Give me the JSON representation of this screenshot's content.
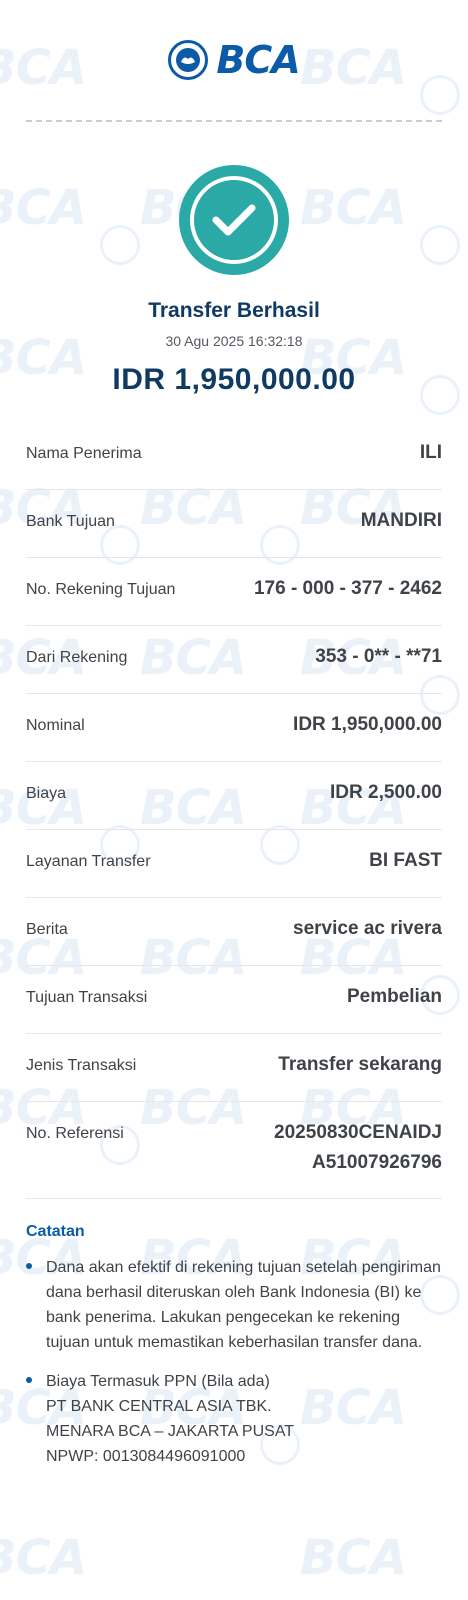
{
  "header": {
    "brand": "BCA"
  },
  "status": {
    "title": "Transfer Berhasil",
    "datetime": "30 Agu 2025 16:32:18",
    "amount": "IDR 1,950,000.00"
  },
  "details": [
    {
      "label": "Nama Penerima",
      "value": "ILI"
    },
    {
      "label": "Bank Tujuan",
      "value": "MANDIRI"
    },
    {
      "label": "No. Rekening Tujuan",
      "value": "176 - 000 - 377 - 2462"
    },
    {
      "label": "Dari Rekening",
      "value": "353 - 0** - **71"
    },
    {
      "label": "Nominal",
      "value": "IDR 1,950,000.00"
    },
    {
      "label": "Biaya",
      "value": "IDR 2,500.00"
    },
    {
      "label": "Layanan Transfer",
      "value": "BI FAST"
    },
    {
      "label": "Berita",
      "value": "service ac rivera"
    },
    {
      "label": "Tujuan Transaksi",
      "value": "Pembelian"
    },
    {
      "label": "Jenis Transaksi",
      "value": "Transfer sekarang"
    },
    {
      "label": "No. Referensi",
      "value": "20250830CENAIDJ A51007926796"
    }
  ],
  "notes": {
    "title": "Catatan",
    "items": [
      "Dana akan efektif di rekening tujuan setelah pengiriman dana berhasil diteruskan oleh Bank Indonesia (BI) ke bank penerima. Lakukan pengecekan ke rekening tujuan untuk memastikan keberhasilan transfer dana.",
      "Biaya Termasuk PPN (Bila ada)\nPT BANK CENTRAL ASIA TBK.\nMENARA BCA – JAKARTA PUSAT\nNPWP: 0013084496091000"
    ]
  },
  "colors": {
    "brand": "#0b5ba8",
    "success": "#2aa9a6",
    "title": "#0f3a63"
  },
  "icons": {
    "logo": "bca-logo-icon",
    "status": "check-circle-icon"
  }
}
